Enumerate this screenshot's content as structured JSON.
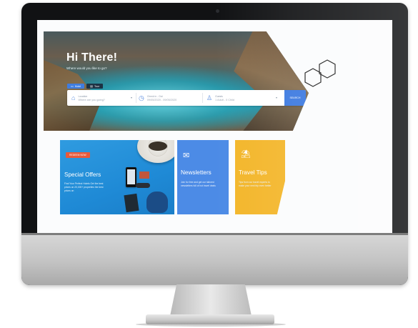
{
  "hero": {
    "title": "Hi There!",
    "subtitle": "Where would you like to go?"
  },
  "tabs": [
    {
      "label": "Hotel",
      "icon": "bed-icon",
      "active": true
    },
    {
      "label": "Tour",
      "icon": "suitcase-icon",
      "active": false
    }
  ],
  "search": {
    "location_label": "Location",
    "location_placeholder": "Where are you going?",
    "dates_label": "Check in - Out",
    "dates_value": "09/05/2020 - 09/05/2020",
    "guests_label": "Guests",
    "guests_value": "1 Adult - 0 Child",
    "button_label": "SEARCH"
  },
  "cards": {
    "offers": {
      "badge": "REDEEM NOW",
      "title": "Special Offers",
      "text": "Find Your Perfect Hotels Get the best prices on 20,000+ properties the best prices on",
      "color": "#1f8ad6"
    },
    "newsletters": {
      "title": "Newsletters",
      "text": "Join for free and get our tailored newsletters full of hot travel deals",
      "icon": "envelope-icon",
      "color": "#4c8be6"
    },
    "tips": {
      "title": "Travel Tips",
      "text": "Tips from our travel experts to make your next trip even better",
      "icon": "palm-tree-icon",
      "color": "#f3b62a"
    }
  }
}
